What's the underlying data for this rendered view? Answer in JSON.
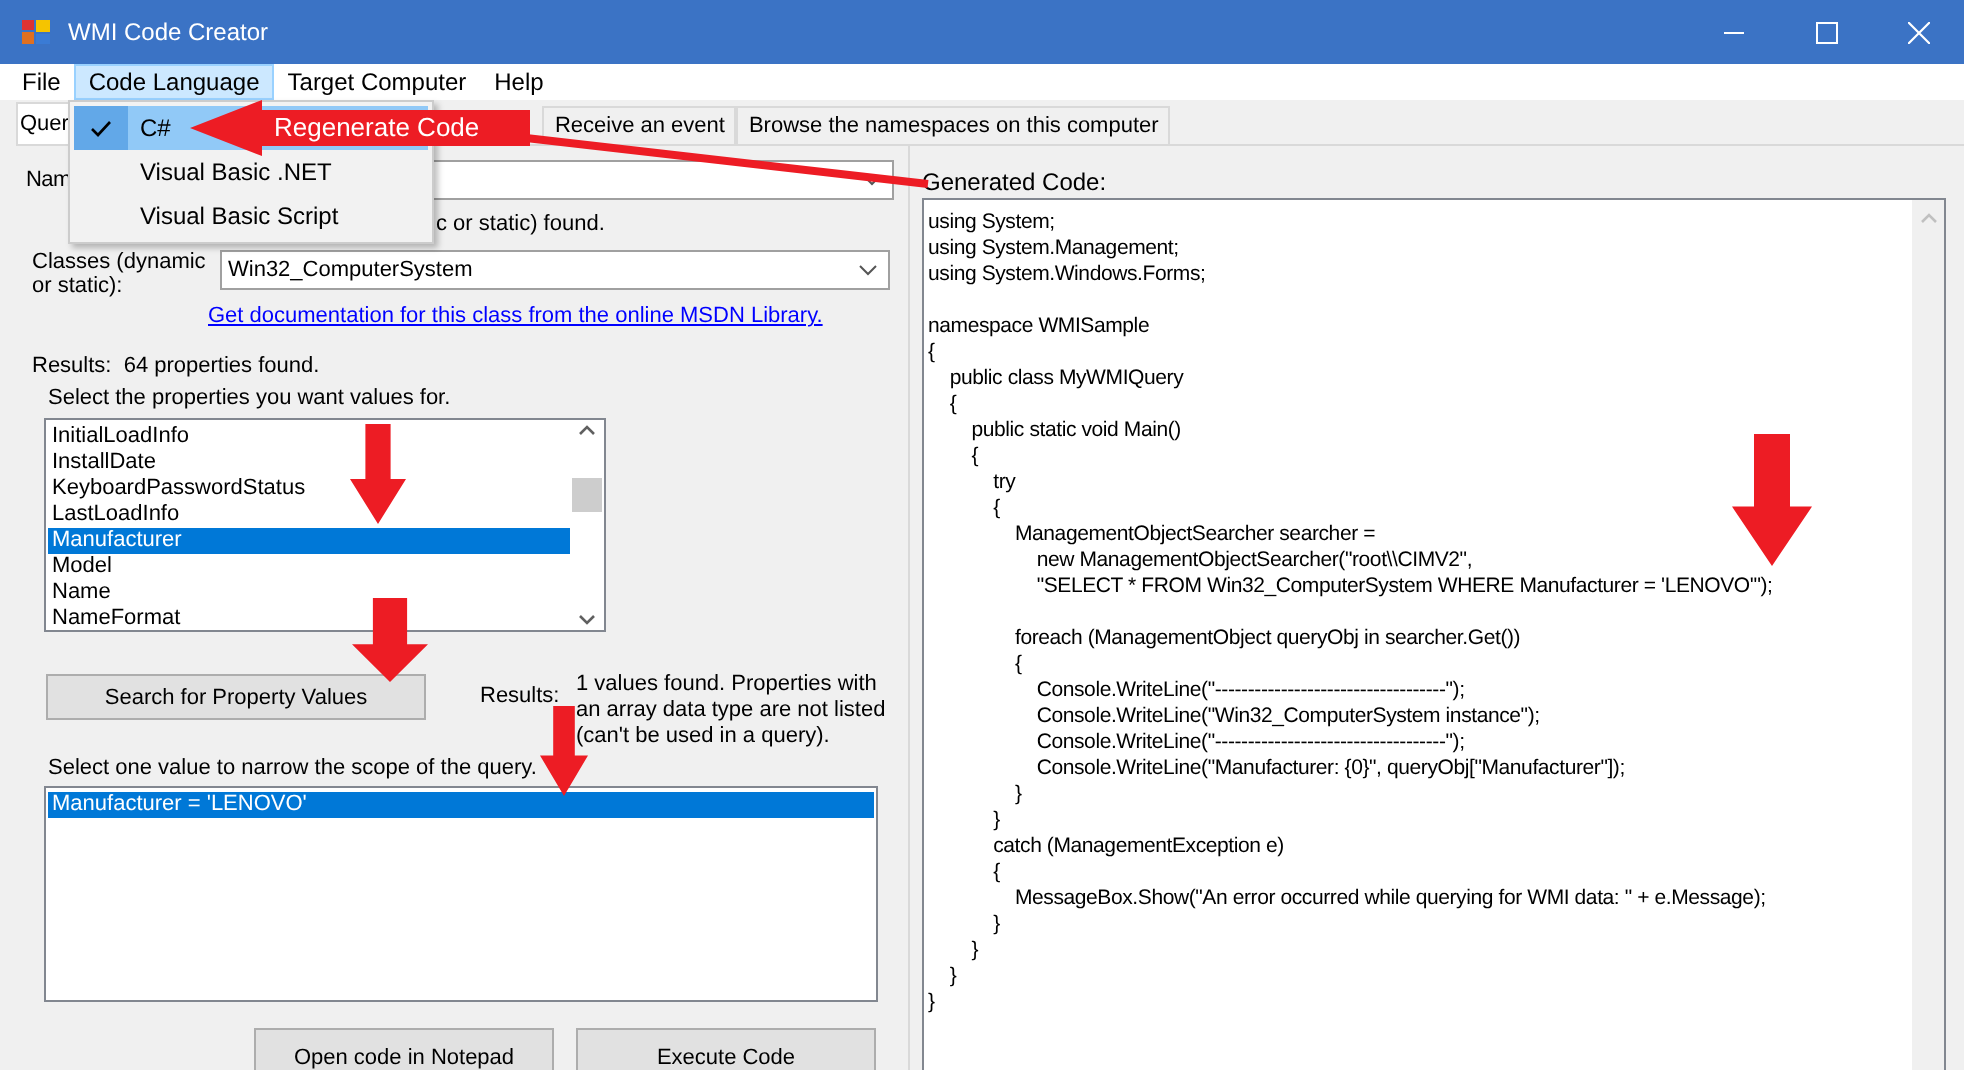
{
  "window": {
    "title": "WMI Code Creator"
  },
  "menu": [
    {
      "label": "File",
      "selected": false
    },
    {
      "label": "Code Language",
      "selected": true
    },
    {
      "label": "Target Computer",
      "selected": false
    },
    {
      "label": "Help",
      "selected": false
    }
  ],
  "language_menu": [
    {
      "label": "C#",
      "checked": true,
      "selected": true
    },
    {
      "label": "Visual Basic .NET",
      "checked": false,
      "selected": false
    },
    {
      "label": "Visual Basic Script",
      "checked": false,
      "selected": false
    }
  ],
  "tabs": [
    {
      "label": "Quer",
      "selected": true
    },
    {
      "label": "Receive an event",
      "selected": false
    },
    {
      "label": "Browse the namespaces on this computer",
      "selected": false
    }
  ],
  "annotation": {
    "text": "Regenerate Code"
  },
  "name_label": "Nam",
  "namespace_status": "c or static) found.",
  "classes": {
    "label": "Classes (dynamic or static):",
    "value": "Win32_ComputerSystem"
  },
  "doc_link": "Get documentation for this class from the online MSDN Library.",
  "property_results": {
    "label": "Results:",
    "text": "64 properties found."
  },
  "properties_prompt": "Select the properties you want values for.",
  "properties": [
    {
      "name": "InitialLoadInfo",
      "selected": false
    },
    {
      "name": "InstallDate",
      "selected": false
    },
    {
      "name": "KeyboardPasswordStatus",
      "selected": false
    },
    {
      "name": "LastLoadInfo",
      "selected": false
    },
    {
      "name": "Manufacturer",
      "selected": true
    },
    {
      "name": "Model",
      "selected": false
    },
    {
      "name": "Name",
      "selected": false
    },
    {
      "name": "NameFormat",
      "selected": false
    }
  ],
  "search_button": "Search for Property Values",
  "value_results": {
    "label": "Results:",
    "text": "1 values found. Properties with an array data type are not listed (can't be used in a query)."
  },
  "values_prompt": "Select one value to narrow the scope of the query.",
  "values": [
    {
      "text": "Manufacturer = 'LENOVO'",
      "selected": true
    }
  ],
  "buttons": [
    "Open code in Notepad",
    "Execute Code"
  ],
  "code": {
    "label": "Generated Code:",
    "blocks": [
      [
        "using System;",
        "using System.Management;",
        "using System.Windows.Forms;"
      ],
      [
        "namespace WMISample",
        "{",
        "    public class MyWMIQuery",
        "    {",
        "        public static void Main()",
        "        {",
        "            try",
        "            {",
        "                ManagementObjectSearcher searcher =",
        "                    new ManagementObjectSearcher(\"root\\\\CIMV2\",",
        "                    \"SELECT * FROM Win32_ComputerSystem WHERE Manufacturer = 'LENOVO'\");"
      ],
      [
        "                foreach (ManagementObject queryObj in searcher.Get())",
        "                {",
        "                    Console.WriteLine(\"-----------------------------------\");",
        "                    Console.WriteLine(\"Win32_ComputerSystem instance\");",
        "                    Console.WriteLine(\"-----------------------------------\");",
        "                    Console.WriteLine(\"Manufacturer: {0}\", queryObj[\"Manufacturer\"]);",
        "                }",
        "            }",
        "            catch (ManagementException e)",
        "            {",
        "                MessageBox.Show(\"An error occurred while querying for WMI data: \" + e.Message);",
        "            }",
        "        }",
        "    }",
        "}"
      ]
    ]
  }
}
